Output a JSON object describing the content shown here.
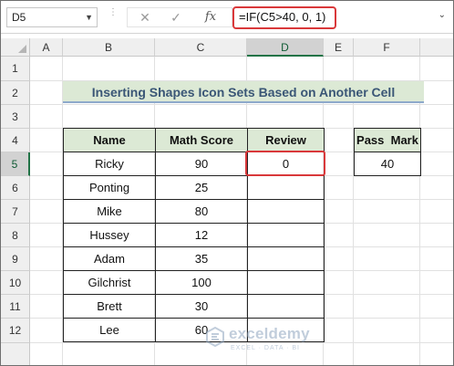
{
  "formula_bar": {
    "name_box": "D5",
    "formula": "=IF(C5>40, 0, 1)",
    "cancel_glyph": "✕",
    "enter_glyph": "✓",
    "fx_label": "fx"
  },
  "columns": [
    "A",
    "B",
    "C",
    "D",
    "E",
    "F"
  ],
  "rows": [
    "1",
    "2",
    "3",
    "4",
    "5",
    "6",
    "7",
    "8",
    "9",
    "10",
    "11",
    "12"
  ],
  "active_cell": {
    "column": "D",
    "row": "5"
  },
  "title": "Inserting Shapes Icon Sets Based on Another Cell",
  "table": {
    "headers": [
      "Name",
      "Math Score",
      "Review"
    ],
    "rows": [
      {
        "name": "Ricky",
        "score": "90",
        "review": "0"
      },
      {
        "name": "Ponting",
        "score": "25",
        "review": ""
      },
      {
        "name": "Mike",
        "score": "80",
        "review": ""
      },
      {
        "name": "Hussey",
        "score": "12",
        "review": ""
      },
      {
        "name": "Adam",
        "score": "35",
        "review": ""
      },
      {
        "name": "Gilchrist",
        "score": "100",
        "review": ""
      },
      {
        "name": "Brett",
        "score": "30",
        "review": ""
      },
      {
        "name": "Lee",
        "score": "60",
        "review": ""
      }
    ]
  },
  "pass_mark": {
    "label": "Pass  Mark",
    "value": "40"
  },
  "watermark": {
    "name": "exceldemy",
    "tagline": "EXCEL · DATA · BI"
  },
  "colors": {
    "highlight_red": "#d9383a",
    "header_green": "#dce9d5",
    "title_text": "#3a5676",
    "excel_green": "#217346"
  }
}
